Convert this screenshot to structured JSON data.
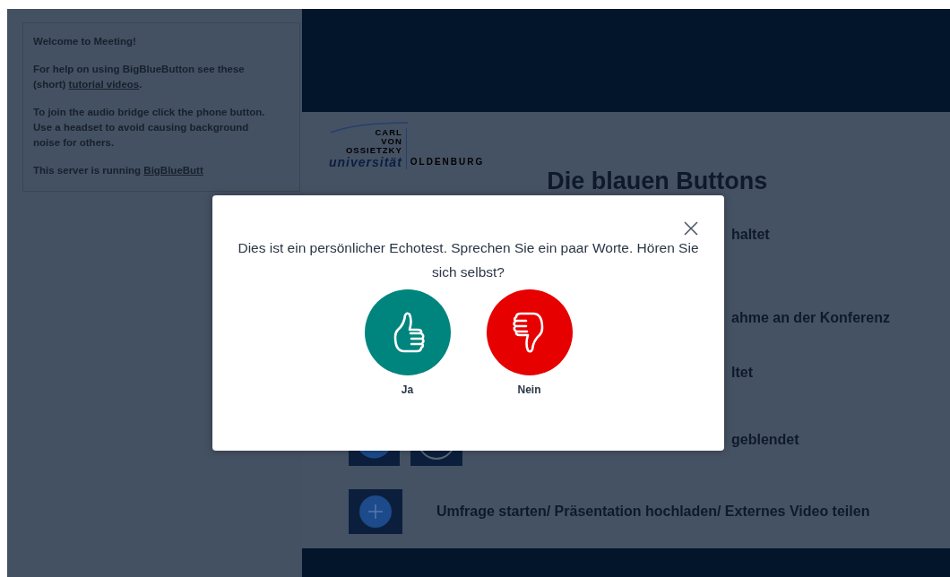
{
  "sidebar": {
    "paragraphs": [
      {
        "kind": "text",
        "text": "Welcome to Meeting!"
      },
      {
        "kind": "link",
        "before": "For help on using BigBlueButton see these (short) ",
        "link": "tutorial videos",
        "after": "."
      },
      {
        "kind": "text",
        "text": "To join the audio bridge click the phone button. Use a headset to avoid causing background noise for others."
      },
      {
        "kind": "link",
        "before": "This server is running ",
        "link": "BigBlueButt"
      }
    ]
  },
  "slide": {
    "logo": {
      "lines": [
        "CARL",
        "VON",
        "OSSIETZKY"
      ],
      "name": "universität",
      "city": "OLDENBURG"
    },
    "title": "Die blauen Buttons",
    "rows": [
      {
        "kind": "fragment",
        "text": "haltet"
      },
      {
        "kind": "fragment",
        "text": "ahme an der Konferenz"
      },
      {
        "kind": "fragment",
        "text": "ltet"
      },
      {
        "kind": "fragment",
        "text": "geblendet",
        "icons": [
          {
            "kind": "square"
          },
          {
            "kind": "circle"
          }
        ]
      },
      {
        "kind": "full",
        "text": "Umfrage starten/ Präsentation hochladen/ Externes Video teilen",
        "icons": [
          {
            "kind": "plus"
          }
        ]
      }
    ]
  },
  "dialog": {
    "message": "Dies ist ein persönlicher Echotest. Sprechen Sie ein paar Worte. Hören Sie sich selbst?",
    "buttons": [
      {
        "kind": "yes",
        "label": "Ja",
        "color": "#00857e"
      },
      {
        "kind": "no",
        "label": "Nein",
        "color": "#e60000"
      }
    ]
  }
}
